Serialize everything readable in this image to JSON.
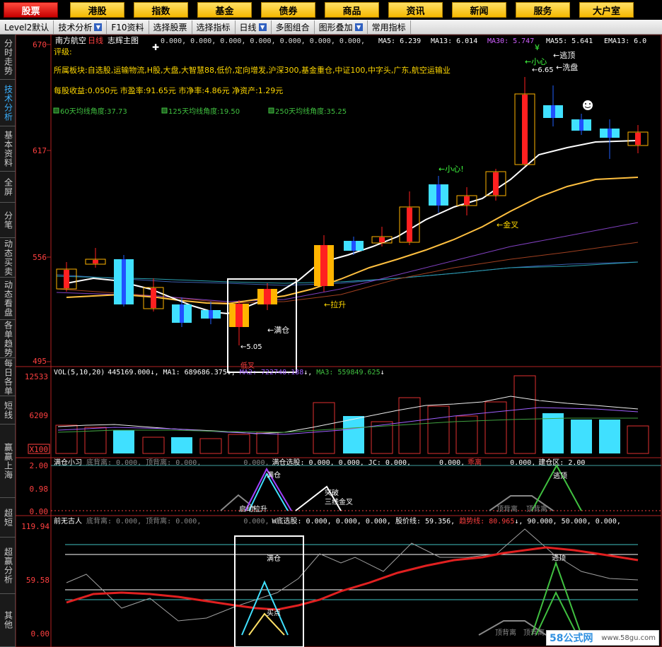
{
  "nav": [
    "股票",
    "港股",
    "指数",
    "基金",
    "债券",
    "商品",
    "资讯",
    "新闻",
    "服务",
    "大户室"
  ],
  "toolbar": [
    "Level2默认",
    "技术分析",
    "F10资料",
    "选择股票",
    "选择指标",
    "日线",
    "多图组合",
    "图形叠加",
    "常用指标"
  ],
  "left_tabs": [
    "分时走势",
    "技术分析",
    "基本资料",
    "全屏",
    "分笔",
    "动态买卖",
    "动态看盘",
    "各单趋势",
    "每日各单",
    "短线",
    "赢赢上海",
    "超短",
    "超赢分析",
    "其他"
  ],
  "main": {
    "stock": "南方航空",
    "period": "日线",
    "indicator": "志辉主图",
    "header_vals": "0.000,    0.000, 0.000, 0.000, 0.000, 0.000, 0.000,",
    "ma5": "MA5: 6.239",
    "ma13": "MA13: 6.014",
    "ma30": "MA30: 5.747",
    "ma55": "MA55: 5.641",
    "ema13": "EMA13: 6.0",
    "rating": "评级:",
    "sector": "所属板块:自选股,运输物流,H股,大盘,大智慧88,低价,定向增发,沪深300,基金重仓,中证100,中字头,广东,航空运输业",
    "eps": "每股收益:0.050元 市盈率:91.65元 市净率:4.86元 净资产:1.29元",
    "ma_angles": [
      "60天均线角度:37.73",
      "125天均线角度:19.50",
      "250天均线角度:35.25"
    ],
    "y_labels": [
      "670",
      "617",
      "556",
      "495"
    ],
    "annotations": {
      "careful1": "小心!",
      "careful2": "小心",
      "escape": "逃顶",
      "wash": "洗盘",
      "high": "6.65",
      "cross": "金叉",
      "rise": "拉升",
      "full": "满仓",
      "low": "5.05",
      "low_cross": "低叉",
      "top_mark": "¥"
    }
  },
  "volume": {
    "title": "VOL(5,10,20)",
    "vol": "445169.000",
    "ma1": "MA1: 689686.375",
    "ma2": "MA2: 722748.188",
    "ma3": "MA3: 559849.625",
    "y_labels": [
      "12533",
      "6209",
      "X100"
    ]
  },
  "ind1": {
    "title": "满仓小习",
    "divergence": "底背离: 0.000, 顶背离: 0.000,",
    "vals": "0.000,",
    "full_pick": "满仓选股: 0.000, 0.000, JC: 0.000,",
    "vals2": "0.000,",
    "deviation_label": "乖离",
    "vals3": "0.000,",
    "build_label": "建仓区: 2.00",
    "y_labels": [
      "2.00",
      "0.98",
      "0.00"
    ],
    "annotations": [
      "满仓",
      "启动拉升",
      "突破",
      "三线金叉",
      "逃顶",
      "顶背离",
      "顶背离"
    ]
  },
  "ind2": {
    "title": "前无古人",
    "divergence": "底背离: 0.000, 顶背离: 0.000,",
    "vals": "0.000,",
    "bottom_pick": "W底选股: 0.000, 0.000, 0.000, 股价线: 59.356",
    "trend_label": "趋势线: 80.965",
    "tail": "90.000, 50.000, 0.000,",
    "y_labels": [
      "119.94",
      "59.58",
      "0.00"
    ],
    "annotations": [
      "满仓",
      "买点",
      "逃顶",
      "顶背离",
      "顶背离"
    ]
  },
  "colors": {
    "up": "#ff2020",
    "down": "#40e0ff",
    "gold": "#ffb400",
    "frame": "#b22222"
  },
  "watermark": {
    "brand": "58公式网",
    "url": "www.58gu.com"
  }
}
